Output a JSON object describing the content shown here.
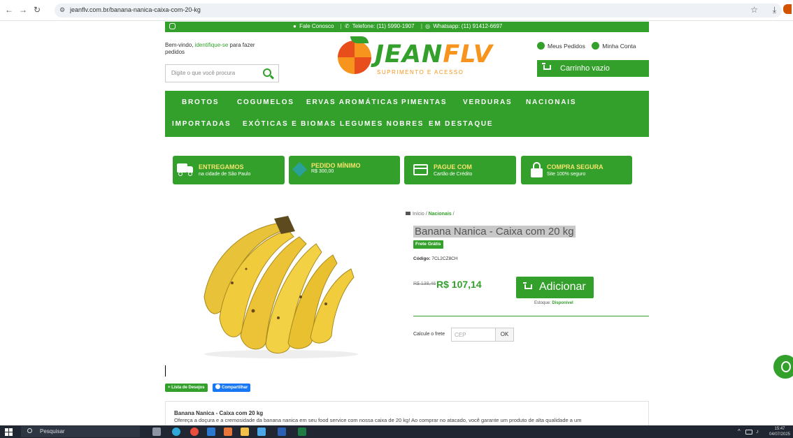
{
  "browser": {
    "url": "jeanflv.com.br/banana-nanica-caixa-com-20-kg",
    "back_icon": "←",
    "forward_icon": "→",
    "reload_icon": "↻",
    "tune_icon": "⚙",
    "star_icon": "☆",
    "download_icon": "⤓"
  },
  "topbar": {
    "contact": "Fale Conosco",
    "phone": "Telefone: (11) 5990-1907",
    "whatsapp": "Whatsapp: (11) 91412-6697",
    "chat_icon": "●",
    "phone_icon": "✆",
    "wa_icon": "◎",
    "separator": "|"
  },
  "header": {
    "welcome_prefix": "Bem-vindo,",
    "welcome_link": "identifique-se",
    "welcome_suffix": "para fazer pedidos",
    "search_placeholder": "Digite o que você procura",
    "logo_part1": "JEAN",
    "logo_part2": "FLV",
    "logo_tagline": "SUPRIMENTO E ACESSO",
    "orders_label": "Meus Pedidos",
    "account_label": "Minha Conta",
    "cart_label": "Carrinho vazio"
  },
  "nav": {
    "items": [
      "BROTOS",
      "COGUMELOS",
      "ERVAS AROMÁTICAS",
      "PIMENTAS",
      "VERDURAS",
      "NACIONAIS",
      "IMPORTADAS",
      "EXÓTICAS E BIOMAS",
      "LEGUMES NOBRES",
      "EM DESTAQUE"
    ]
  },
  "badges": [
    {
      "title": "ENTREGAMOS",
      "subtitle": "na cidade de São Paulo"
    },
    {
      "title": "PEDIDO MÍNIMO",
      "subtitle": "R$ 300,00"
    },
    {
      "title": "PAGUE COM",
      "subtitle": "Cartão de Crédito"
    },
    {
      "title": "COMPRA SEGURA",
      "subtitle": "Site 100% seguro"
    }
  ],
  "breadcrumb": {
    "home": "Início",
    "sep": "/",
    "category": "Nacionais"
  },
  "product": {
    "title": "Banana Nanica - Caixa com 20 kg",
    "shipping_badge": "Frete Grátis",
    "code_label": "Código:",
    "code_value": "7CL2CZ8CH",
    "old_price": "R$ 138,46",
    "price": "R$ 107,14",
    "add_button": "Adicionar",
    "stock_label": "Estoque:",
    "stock_value": "Disponível",
    "freight_label": "Calcule o frete",
    "cep_placeholder": "CEP",
    "ok_button": "OK",
    "wishlist_button": "+ Lista de Desejos",
    "share_button": "Compartilhar"
  },
  "description": {
    "title": "Banana Nanica - Caixa com 20 kg",
    "text": "Ofereça a doçura e a cremosidade da banana nanica em seu food service com nossa caixa de 20 kg! Ao comprar no atacado, você garante um produto de alta qualidade a um"
  },
  "taskbar": {
    "search_label": "Pesquisar",
    "time": "15:47",
    "date": "04/07/2025",
    "up_icon": "^",
    "volume_icon": "♪"
  },
  "colors": {
    "brand_green": "#33a02c",
    "brand_orange": "#f7941d",
    "badge_title_yellow": "#f7e36c"
  }
}
